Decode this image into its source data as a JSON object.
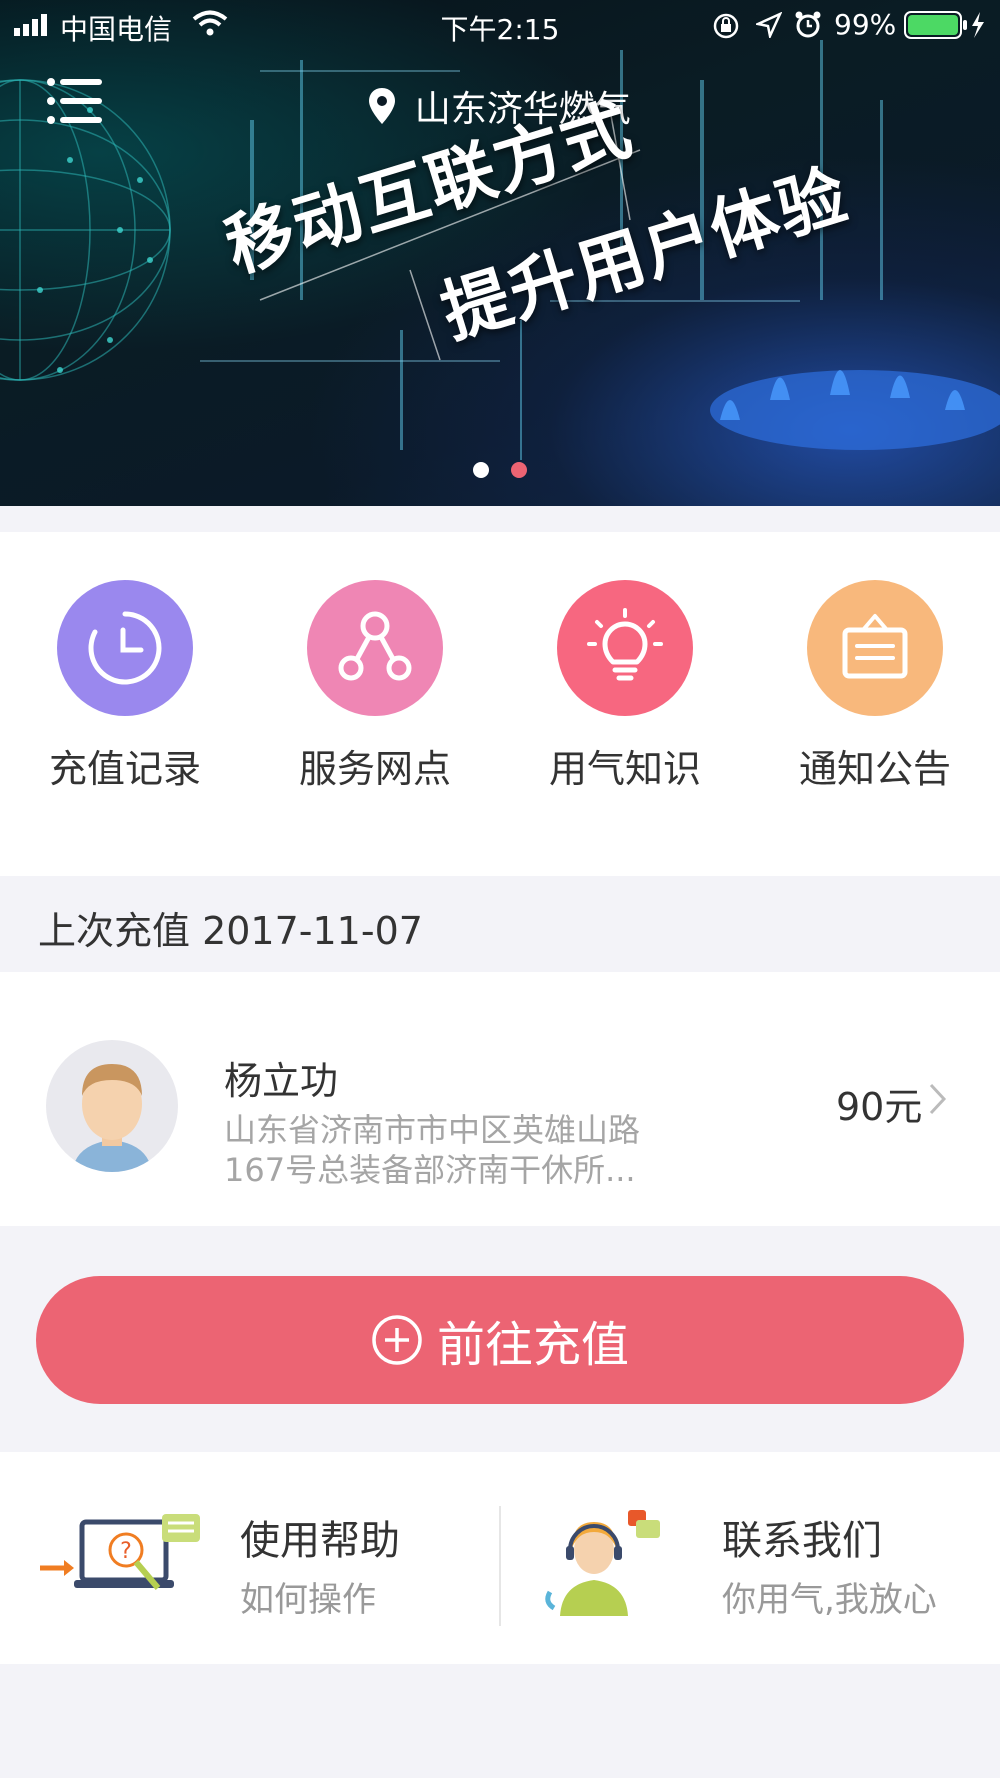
{
  "status_bar": {
    "carrier": "中国电信",
    "time": "下午2:15",
    "battery": "99%"
  },
  "banner": {
    "location": "山东济华燃气",
    "headline_line1": "移动互联方式",
    "headline_line2": "提升用户体验",
    "slide_count": 2,
    "active_slide": 2
  },
  "quick_actions": [
    {
      "label": "充值记录",
      "icon": "clock-icon",
      "color": "#9a88ee"
    },
    {
      "label": "服务网点",
      "icon": "network-icon",
      "color": "#ef86b4"
    },
    {
      "label": "用气知识",
      "icon": "lightbulb-icon",
      "color": "#f76780"
    },
    {
      "label": "通知公告",
      "icon": "notice-board-icon",
      "color": "#f8b87c"
    }
  ],
  "last_recharge": {
    "text": "上次充值 2017-11-07"
  },
  "user": {
    "name": "杨立功",
    "address_line1": "山东省济南市市中区英雄山路",
    "address_line2": "167号总装备部济南干休所...",
    "amount": "90元"
  },
  "recharge_button": {
    "label": "前往充值"
  },
  "help": {
    "usage_title": "使用帮助",
    "usage_sub": "如何操作",
    "contact_title": "联系我们",
    "contact_sub": "你用气,我放心"
  },
  "colors": {
    "accent": "#ec6473",
    "dot_active": "#ec6473",
    "dot_inactive": "#ffffff"
  }
}
